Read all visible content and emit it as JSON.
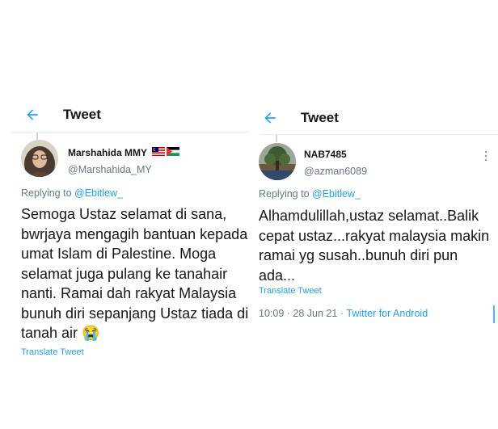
{
  "left_tweet": {
    "header_title": "Tweet",
    "display_name": "Marshahida MMY",
    "flags": [
      "malaysia-flag",
      "palestine-flag"
    ],
    "handle": "@Marshahida_MY",
    "replying_prefix": "Replying to",
    "replying_to": "@Ebitlew_",
    "text": "Semoga Ustaz selamat di sana, bwrjaya mengagih bantuan kepada umat Islam di Palestine. Moga selamat juga pulang ke tanahair nanti. Ramai dah rakyat Malaysia bunuh diri sepanjang Ustaz tiada di tanah air 😭",
    "translate_label": "Translate Tweet"
  },
  "right_tweet": {
    "header_title": "Tweet",
    "display_name": "NAB7485",
    "handle": "@azman6089",
    "replying_prefix": "Replying to",
    "replying_to": "@Ebitlew_",
    "text": "Alhamdulillah,ustaz selamat..Balik cepat ustaz...rakyat malaysia makin ramai yg susah..bunuh diri pun ada...",
    "translate_label": "Translate Tweet",
    "timestamp": "10:09 · 28 Jun 21 · ",
    "source": "Twitter for Android"
  },
  "colors": {
    "accent": "#1da1f2",
    "text": "#14171a",
    "muted": "#657786"
  },
  "icons": [
    "back-arrow-icon",
    "more-vertical-icon"
  ]
}
